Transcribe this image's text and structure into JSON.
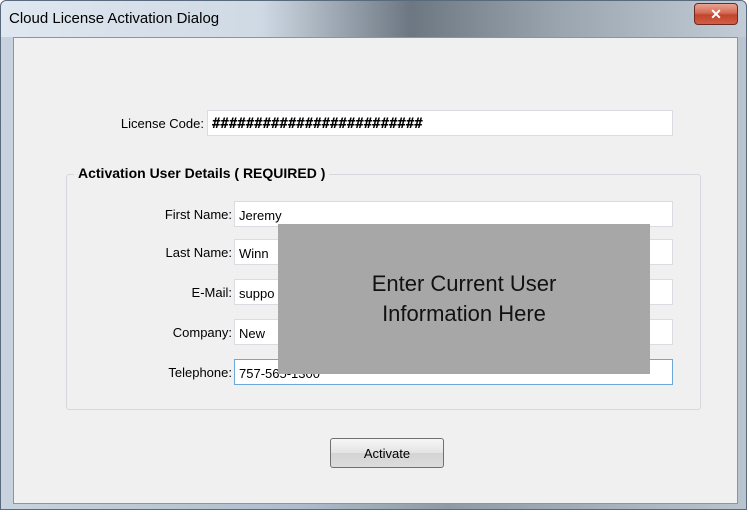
{
  "window": {
    "title": "Cloud License Activation Dialog",
    "close_icon": "close-icon"
  },
  "license": {
    "label": "License Code:",
    "value": "#########################"
  },
  "group": {
    "title": "Activation User Details ( REQUIRED )"
  },
  "fields": [
    {
      "label": "First Name:",
      "value": "Jeremy"
    },
    {
      "label": "Last Name:",
      "value": "Winn"
    },
    {
      "label": "E-Mail:",
      "value": "suppo"
    },
    {
      "label": "Company:",
      "value": "New"
    },
    {
      "label": "Telephone:",
      "value": "757-565-1300"
    }
  ],
  "overlay": {
    "line1": "Enter Current User",
    "line2": "Information Here"
  },
  "buttons": {
    "activate": "Activate"
  }
}
